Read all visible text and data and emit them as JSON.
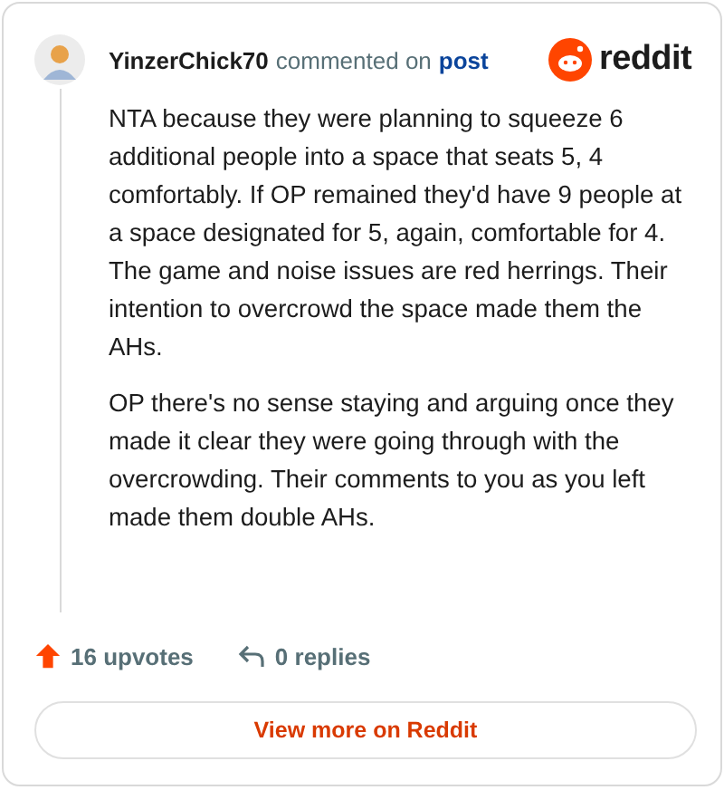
{
  "comment": {
    "author": "YinzerChick70",
    "action": "commented on",
    "target": "post"
  },
  "brand": "reddit",
  "paragraphs": [
    "NTA because they were planning to squeeze 6 additional people into a space that seats 5, 4 comfortably. If OP remained they'd have 9 people at a space designated for 5, again, comfortable for 4. The game and noise issues are red herrings. Their intention to overcrowd the space made them the AHs.",
    "OP there's no sense staying and arguing once they made it clear they were going through with the overcrowding. Their comments to you as you left made them double AHs."
  ],
  "upvotes": "16 upvotes",
  "replies": "0 replies",
  "button": "View more on Reddit"
}
